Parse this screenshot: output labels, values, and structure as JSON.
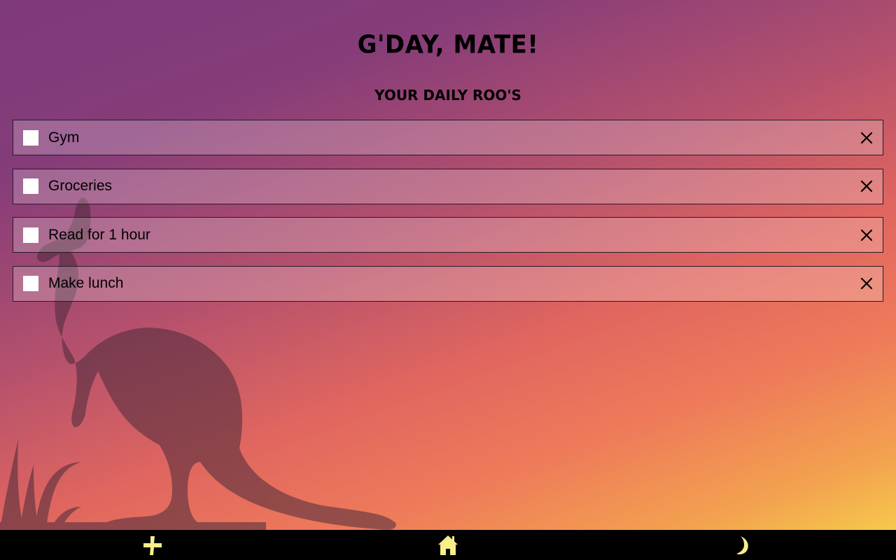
{
  "header": {
    "title": "G'DAY, MATE!",
    "subtitle": "YOUR DAILY ROO'S"
  },
  "todos": [
    {
      "label": "Gym",
      "checked": false
    },
    {
      "label": "Groceries",
      "checked": false
    },
    {
      "label": "Read for 1 hour",
      "checked": false
    },
    {
      "label": "Make lunch",
      "checked": false
    }
  ],
  "nav": {
    "items": [
      {
        "icon": "plus-icon"
      },
      {
        "icon": "home-icon"
      },
      {
        "icon": "moon-icon"
      }
    ],
    "icon_color": "#f7ee8a"
  },
  "colors": {
    "gradient_top": "#7f3a7b",
    "gradient_mid": "#e0665f",
    "gradient_bottom": "#f7d84a",
    "silhouette": "#4a2a3a"
  }
}
